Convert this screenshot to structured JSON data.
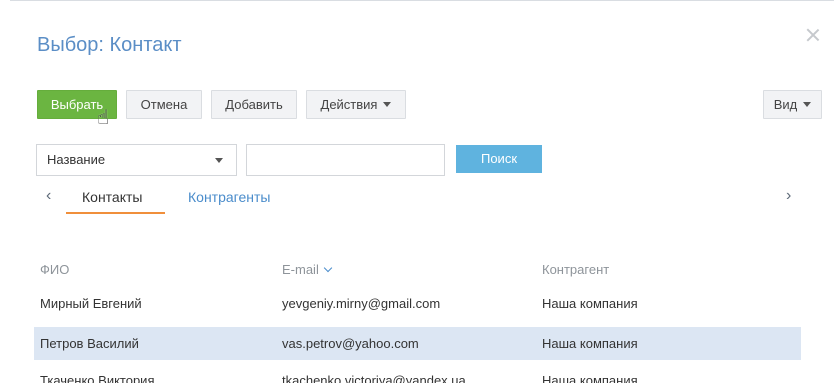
{
  "dialog": {
    "title": "Выбор: Контакт",
    "close_icon": "close-icon"
  },
  "toolbar": {
    "select_label": "Выбрать",
    "cancel_label": "Отмена",
    "add_label": "Добавить",
    "actions_label": "Действия",
    "view_label": "Вид"
  },
  "filter": {
    "field_value": "Название",
    "search_value": "",
    "search_button": "Поиск"
  },
  "tabs": [
    {
      "label": "Контакты",
      "active": true
    },
    {
      "label": "Контрагенты",
      "active": false
    }
  ],
  "table": {
    "columns": [
      "ФИО",
      "E-mail",
      "Контрагент"
    ],
    "rows": [
      {
        "name": "Мирный Евгений",
        "email": "yevgeniy.mirny@gmail.com",
        "account": "Наша компания",
        "selected": false
      },
      {
        "name": "Петров Василий",
        "email": "vas.petrov@yahoo.com",
        "account": "Наша компания",
        "selected": true
      },
      {
        "name": "Ткаченко Виктория",
        "email": "tkachenko.victoriya@yandex.ua",
        "account": "Наша компания",
        "selected": false
      }
    ]
  },
  "colors": {
    "title": "#5b8ec6",
    "primary_button": "#6bb541",
    "search_button": "#5fb3df",
    "tab_active_underline": "#f08f3b",
    "selected_row": "#dce6f3"
  }
}
